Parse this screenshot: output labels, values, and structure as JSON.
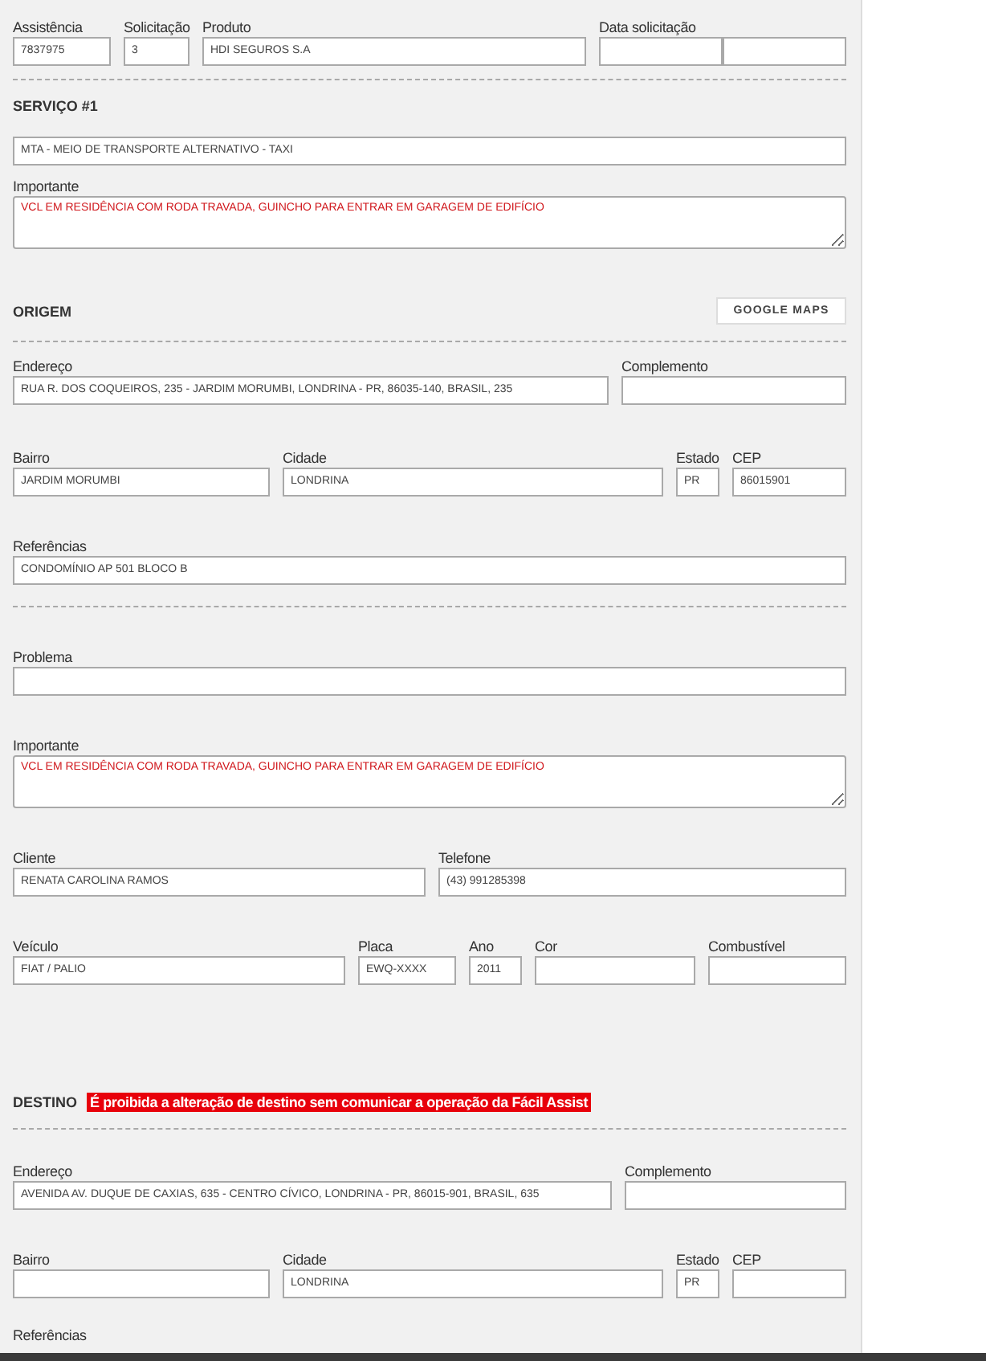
{
  "header": {
    "assistance": {
      "label": "Assistência",
      "value": "7837975"
    },
    "request": {
      "label": "Solicitação",
      "value": "3"
    },
    "product": {
      "label": "Produto",
      "value": "HDI SEGUROS S.A"
    },
    "request_date": {
      "label": "Data solicitação"
    }
  },
  "service": {
    "title": "SERVIÇO #1",
    "type": {
      "value": "MTA - MEIO DE TRANSPORTE ALTERNATIVO - TAXI"
    },
    "important": {
      "label": "Importante",
      "value": "VCL EM RESIDÊNCIA COM RODA TRAVADA, GUINCHO PARA ENTRAR EM GARAGEM DE EDIFÍCIO"
    }
  },
  "origin": {
    "title": "ORIGEM",
    "maps_button": "GOOGLE MAPS",
    "address": {
      "label": "Endereço",
      "value": "RUA R. DOS COQUEIROS, 235 - JARDIM MORUMBI, LONDRINA - PR, 86035-140, BRASIL, 235"
    },
    "complement": {
      "label": "Complemento"
    },
    "neighborhood": {
      "label": "Bairro",
      "value": "JARDIM MORUMBI"
    },
    "city": {
      "label": "Cidade",
      "value": "LONDRINA"
    },
    "state": {
      "label": "Estado",
      "value": "PR"
    },
    "zip": {
      "label": "CEP",
      "value": "86015901"
    },
    "references": {
      "label": "Referências",
      "value": "CONDOMÍNIO AP 501 BLOCO B"
    }
  },
  "details": {
    "problem": {
      "label": "Problema"
    },
    "important": {
      "label": "Importante",
      "value": "VCL EM RESIDÊNCIA COM RODA TRAVADA, GUINCHO PARA ENTRAR EM GARAGEM DE EDIFÍCIO"
    },
    "client": {
      "label": "Cliente",
      "value": "RENATA CAROLINA RAMOS"
    },
    "phone": {
      "label": "Telefone",
      "value": "(43) 991285398"
    },
    "vehicle": {
      "label": "Veículo",
      "value": "FIAT / PALIO"
    },
    "plate": {
      "label": "Placa",
      "value": "EWQ-XXXX"
    },
    "year": {
      "label": "Ano",
      "value": "2011"
    },
    "color": {
      "label": "Cor"
    },
    "fuel": {
      "label": "Combustível"
    }
  },
  "destination": {
    "title": "DESTINO",
    "warning": "É proibida a alteração de destino sem comunicar a operação da Fácil Assist",
    "address": {
      "label": "Endereço",
      "value": "AVENIDA AV. DUQUE DE CAXIAS, 635 - CENTRO CÍVICO, LONDRINA - PR, 86015-901, BRASIL, 635"
    },
    "complement": {
      "label": "Complemento"
    },
    "neighborhood": {
      "label": "Bairro"
    },
    "city": {
      "label": "Cidade",
      "value": "LONDRINA"
    },
    "state": {
      "label": "Estado",
      "value": "PR"
    },
    "zip": {
      "label": "CEP"
    },
    "references": {
      "label": "Referências"
    }
  }
}
